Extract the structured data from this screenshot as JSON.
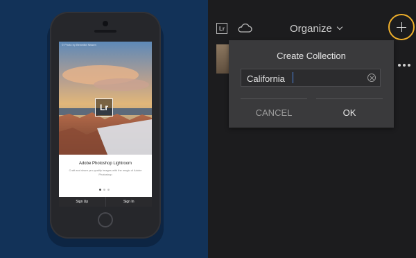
{
  "phone": {
    "photo_credit": "© Photo by Benedikt Nissen",
    "logo_text": "Lr",
    "app_title": "Adobe Photoshop Lightroom",
    "app_tagline": "Craft and share pro-quality images with the magic of Adobe Photoshop",
    "signup_label": "Sign Up",
    "signin_label": "Sign In"
  },
  "toolbar": {
    "lr_icon_text": "Lr",
    "organize_label": "Organize",
    "accent_color": "#f0b02b"
  },
  "dialog": {
    "title": "Create Collection",
    "name_value": "California",
    "cancel_label": "CANCEL",
    "ok_label": "OK"
  },
  "icons": [
    "lr-icon",
    "cloud-icon",
    "chevron-down-icon",
    "add-icon",
    "more-icon",
    "clear-icon"
  ]
}
